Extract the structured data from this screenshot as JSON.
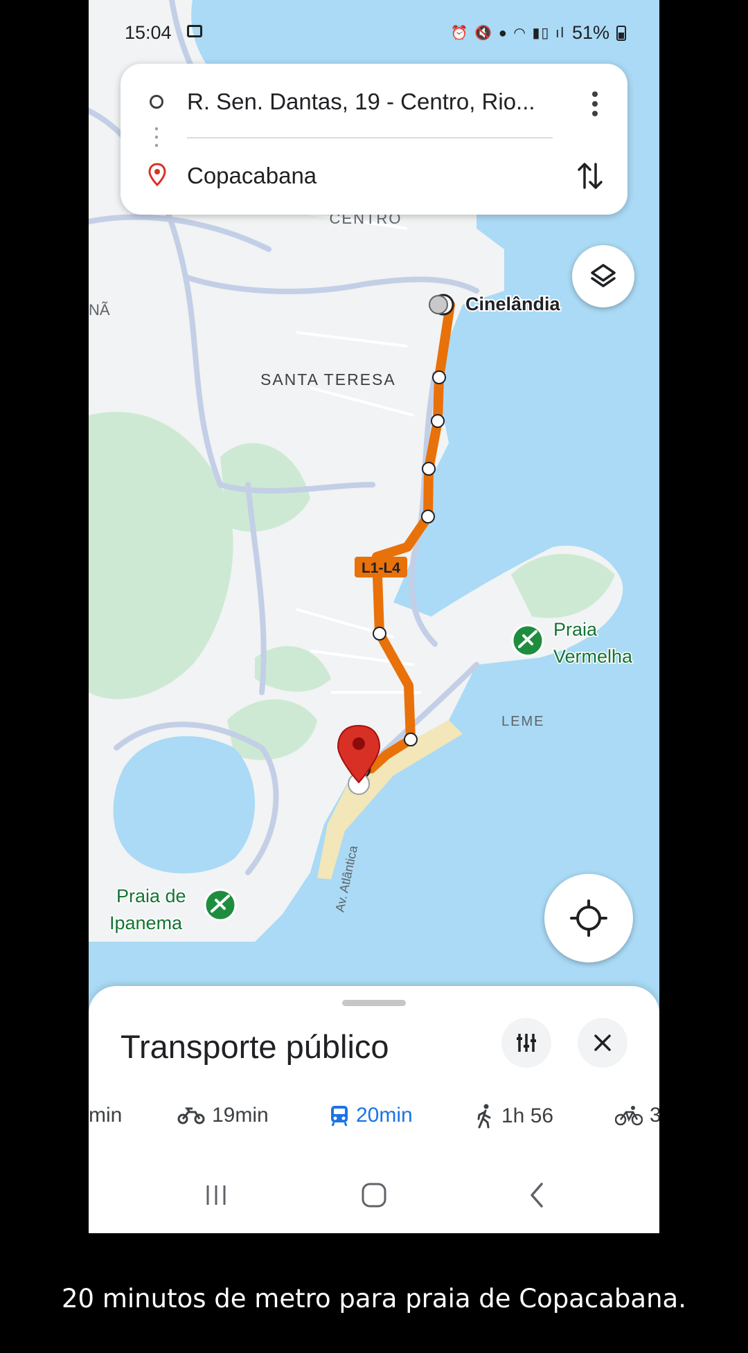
{
  "status_bar": {
    "time": "15:04",
    "battery": "51%",
    "icons": [
      "image-icon",
      "alarm-icon",
      "mute-icon",
      "location-icon",
      "wifi-icon",
      "volte-icon",
      "signal-icon",
      "battery-icon"
    ]
  },
  "directions": {
    "origin": "R. Sen. Dantas, 19 - Centro, Rio...",
    "destination": "Copacabana"
  },
  "map": {
    "labels": {
      "centro": "CENTRO",
      "cinelandia": "Cinelândia",
      "santa_teresa": "SANTA TERESA",
      "edge_left": "NÃ",
      "route_badge": "L1-L4",
      "praia_vermelha_1": "Praia",
      "praia_vermelha_2": "Vermelha",
      "leme": "LEME",
      "av_atlantica": "Av. Atlântica",
      "ipanema_1": "Praia de",
      "ipanema_2": "Ipanema"
    },
    "route_color": "#e8710a",
    "pin_color": "#d93025",
    "beach_icon_color": "#1e8e3e"
  },
  "sheet": {
    "title": "Transporte público",
    "modes": [
      {
        "icon": "car-icon",
        "label": "min",
        "active": false
      },
      {
        "icon": "motorcycle-icon",
        "label": "19min",
        "active": false
      },
      {
        "icon": "transit-icon",
        "label": "20min",
        "active": true
      },
      {
        "icon": "walk-icon",
        "label": "1h 56",
        "active": false
      },
      {
        "icon": "bike-icon",
        "label": "3",
        "active": false
      }
    ]
  },
  "accent_color": "#1a73e8",
  "caption": "20 minutos de metro para praia de Copacabana."
}
